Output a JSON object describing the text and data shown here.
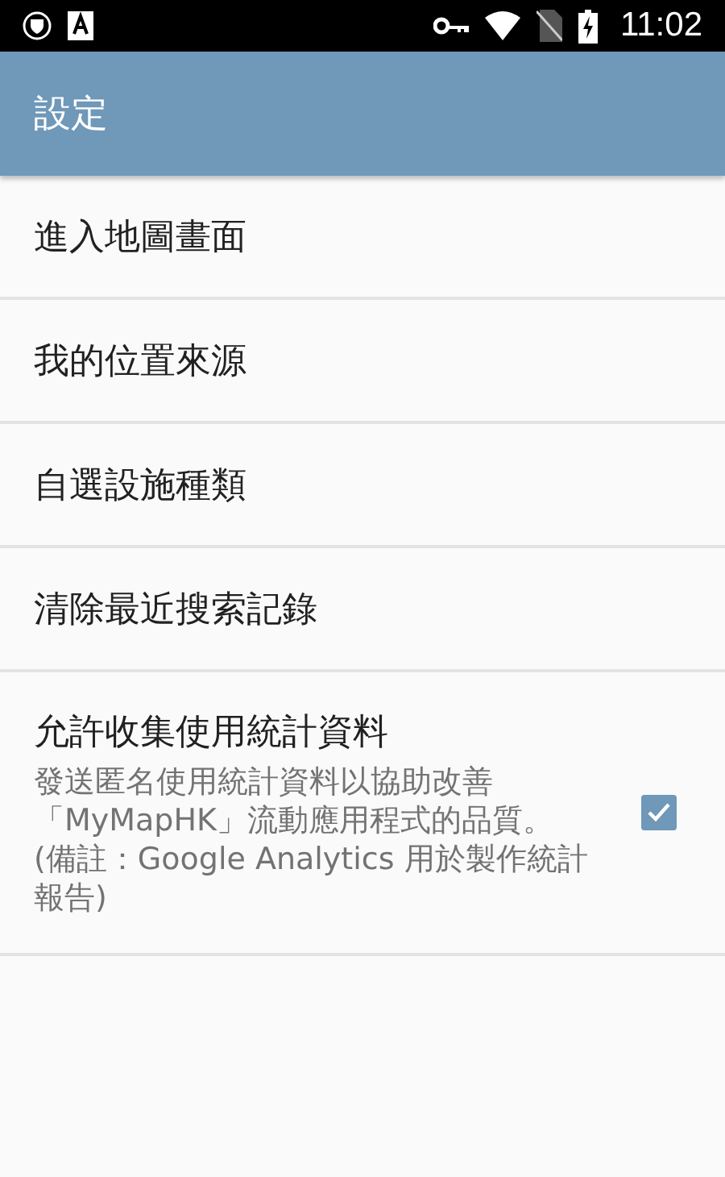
{
  "status_bar": {
    "time": "11:02"
  },
  "app_bar": {
    "title": "設定"
  },
  "items": [
    {
      "kind": "plain",
      "title": "進入地圖畫面"
    },
    {
      "kind": "plain",
      "title": "我的位置來源"
    },
    {
      "kind": "plain",
      "title": "自選設施種類"
    },
    {
      "kind": "plain",
      "title": "清除最近搜索記錄"
    },
    {
      "kind": "checkbox",
      "title": "允許收集使用統計資料",
      "summary": "發送匿名使用統計資料以協助改善「MyMapHK」流動應用程式的品質。(備註：Google Analytics 用於製作統計報告)",
      "checked": true
    }
  ]
}
